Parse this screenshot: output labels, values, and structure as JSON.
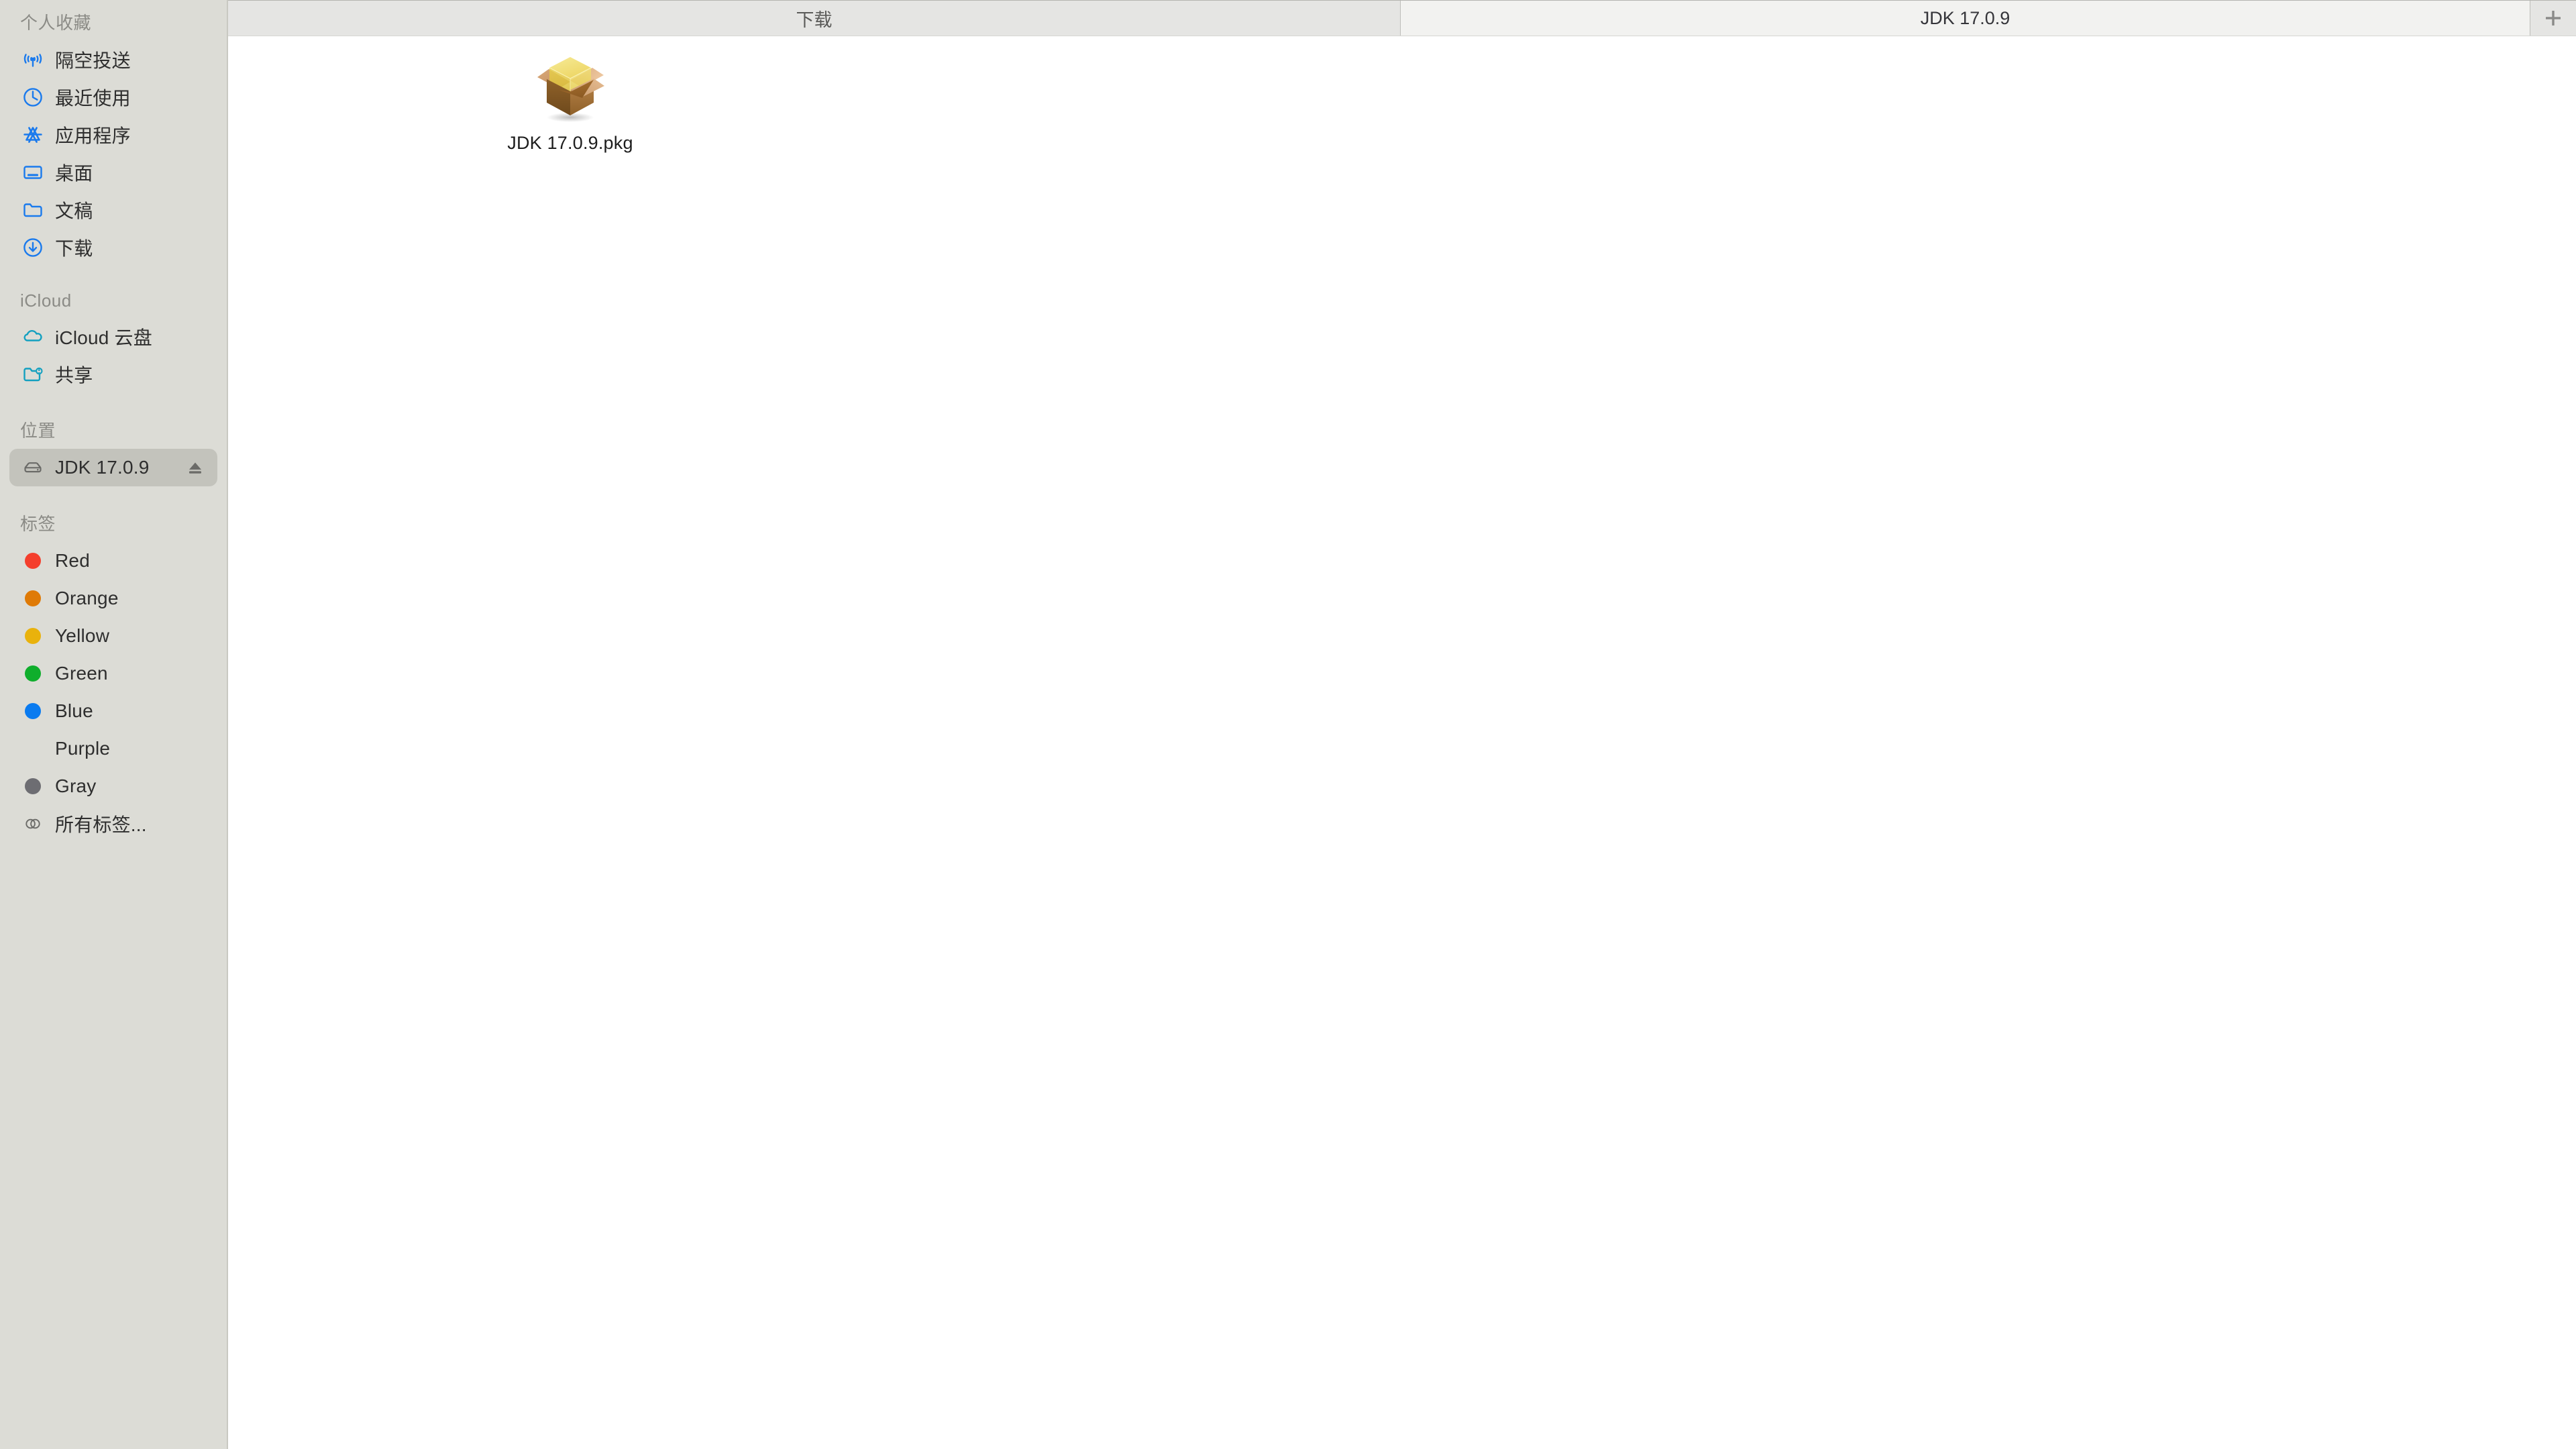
{
  "window": {
    "active_tab_title": "JDK 17.0.9"
  },
  "tabbar": {
    "tabs": [
      {
        "label": "下载",
        "active": false
      },
      {
        "label": "JDK 17.0.9",
        "active": true
      }
    ],
    "new_tab_icon": "plus-icon",
    "new_tab_label": "+"
  },
  "sidebar": {
    "sections": [
      {
        "header": "个人收藏",
        "items": [
          {
            "label": "隔空投送",
            "icon": "airdrop-icon",
            "color": "#1a7aed"
          },
          {
            "label": "最近使用",
            "icon": "clock-icon",
            "color": "#1a7aed"
          },
          {
            "label": "应用程序",
            "icon": "applications-icon",
            "color": "#1a7aed"
          },
          {
            "label": "桌面",
            "icon": "desktop-icon",
            "color": "#1a7aed"
          },
          {
            "label": "文稿",
            "icon": "folder-icon",
            "color": "#1a7aed"
          },
          {
            "label": "下载",
            "icon": "download-icon",
            "color": "#1a7aed"
          }
        ]
      },
      {
        "header": "iCloud",
        "items": [
          {
            "label": "iCloud 云盘",
            "icon": "cloud-icon",
            "color": "#13a0c0"
          },
          {
            "label": "共享",
            "icon": "shared-folder-icon",
            "color": "#13a0c0"
          }
        ]
      },
      {
        "header": "位置",
        "items": [
          {
            "label": "JDK 17.0.9",
            "icon": "external-drive-icon",
            "color": "#6b6b68",
            "selected": true,
            "eject": true,
            "eject_icon": "eject-icon"
          }
        ]
      },
      {
        "header": "标签",
        "items": [
          {
            "label": "Red",
            "icon": "tag-dot",
            "color": "#f43f2d"
          },
          {
            "label": "Orange",
            "icon": "tag-dot",
            "color": "#df7a06"
          },
          {
            "label": "Yellow",
            "icon": "tag-dot",
            "color": "#e9b20c"
          },
          {
            "label": "Green",
            "icon": "tag-dot",
            "color": "#0fae2c"
          },
          {
            "label": "Blue",
            "icon": "tag-dot",
            "color": "#0a7bf0"
          },
          {
            "label": "Purple",
            "icon": "tag-dot",
            "color": "#a martin"
          },
          {
            "label": "Gray",
            "icon": "tag-dot",
            "color": "#6d6d72"
          },
          {
            "label": "所有标签...",
            "icon": "all-tags-icon",
            "color": "#6b6b68"
          }
        ]
      }
    ]
  },
  "content": {
    "files": [
      {
        "name": "JDK 17.0.9.pkg",
        "icon": "installer-package-icon"
      }
    ]
  },
  "colors": {
    "sidebar_bg": "#dcdcd6",
    "sidebar_selected": "#c3c3bc",
    "tab_inactive": "#e5e5e3",
    "tab_active": "#f2f2f0",
    "content_bg": "#ffffff",
    "accent_blue": "#1a7aed",
    "accent_cyan": "#13a0c0",
    "text_primary": "#2e2e2e",
    "text_header": "#8b8b86"
  }
}
